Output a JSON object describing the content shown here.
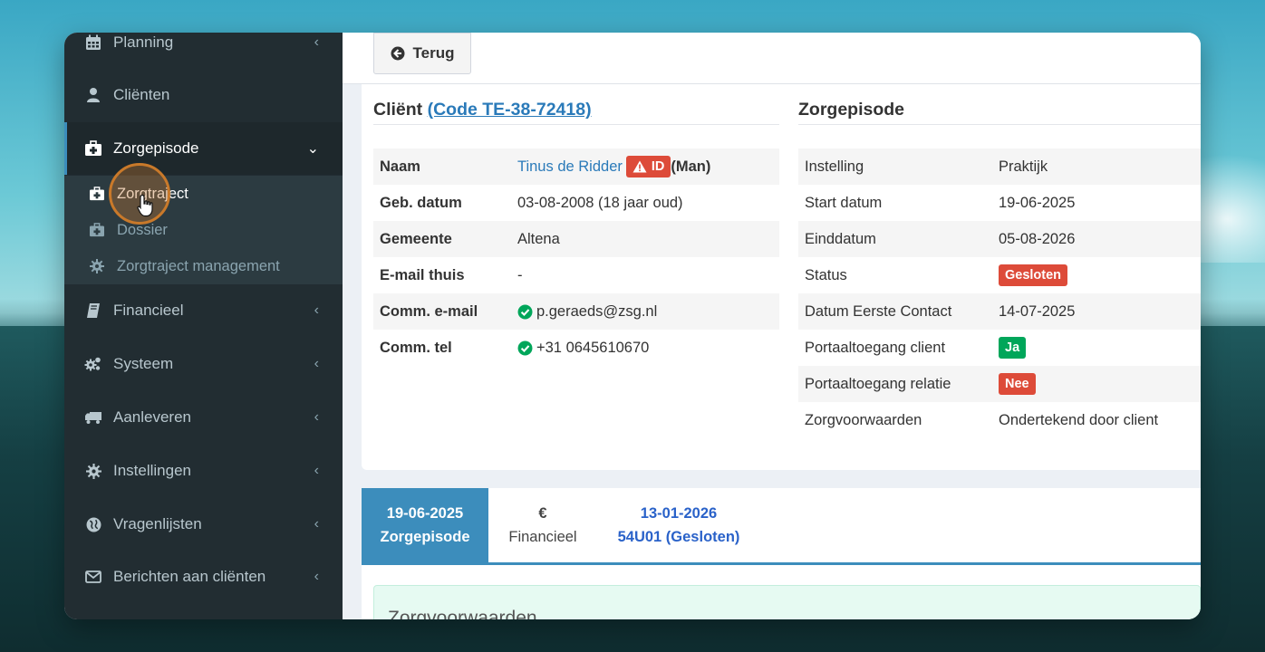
{
  "sidebar": {
    "items": [
      {
        "label": "Planning",
        "icon": "calendar-icon"
      },
      {
        "label": "Cliënten",
        "icon": "user-icon"
      },
      {
        "label": "Zorgepisode",
        "icon": "medkit-icon"
      },
      {
        "label": "Financieel",
        "icon": "book-icon"
      },
      {
        "label": "Systeem",
        "icon": "cogs-icon"
      },
      {
        "label": "Aanleveren",
        "icon": "truck-icon"
      },
      {
        "label": "Instellingen",
        "icon": "gear-icon"
      },
      {
        "label": "Vragenlijsten",
        "icon": "globe-icon"
      },
      {
        "label": "Berichten aan cliënten",
        "icon": "envelope-icon"
      }
    ],
    "submenu": [
      {
        "label": "Zorgtraject",
        "icon": "medkit-icon"
      },
      {
        "label": "Dossier",
        "icon": "medkit-icon"
      },
      {
        "label": "Zorgtraject management",
        "icon": "gear-icon"
      }
    ]
  },
  "toolbar": {
    "back_label": "Terug"
  },
  "client": {
    "title": "Cliënt",
    "code_link": "(Code TE-38-72418)",
    "rows": [
      {
        "label": "Naam",
        "name": "Tinus de Ridder",
        "badge": "ID",
        "suffix": "(Man)"
      },
      {
        "label": "Geb. datum",
        "value": "03-08-2008 (18 jaar oud)"
      },
      {
        "label": "Gemeente",
        "value": "Altena"
      },
      {
        "label": "E-mail thuis",
        "value": "-"
      },
      {
        "label": "Comm. e-mail",
        "value": "p.geraeds@zsg.nl"
      },
      {
        "label": "Comm. tel",
        "value": "+31 0645610670"
      }
    ]
  },
  "episode": {
    "title": "Zorgepisode",
    "rows": [
      {
        "label": "Instelling",
        "value": "Praktijk"
      },
      {
        "label": "Start datum",
        "value": "19-06-2025"
      },
      {
        "label": "Einddatum",
        "value": "05-08-2026"
      },
      {
        "label": "Status",
        "value": "Gesloten"
      },
      {
        "label": "Datum Eerste Contact",
        "value": "14-07-2025"
      },
      {
        "label": "Portaaltoegang client",
        "value": "Ja"
      },
      {
        "label": "Portaaltoegang relatie",
        "value": "Nee"
      },
      {
        "label": "Zorgvoorwaarden",
        "value": "Ondertekend door client"
      }
    ]
  },
  "tabs": [
    {
      "line1": "19-06-2025",
      "line2": "Zorgepisode"
    },
    {
      "line1": "€",
      "line2": "Financieel"
    },
    {
      "line1": "13-01-2026",
      "line2": "54U01 (Gesloten)"
    }
  ],
  "callout": {
    "title": "Zorgvoorwaarden"
  },
  "colors": {
    "sidebar": "#222d32",
    "accent": "#3c8dbc",
    "danger": "#dd4b39",
    "success": "#00a65a",
    "link": "#2a7ab9"
  }
}
